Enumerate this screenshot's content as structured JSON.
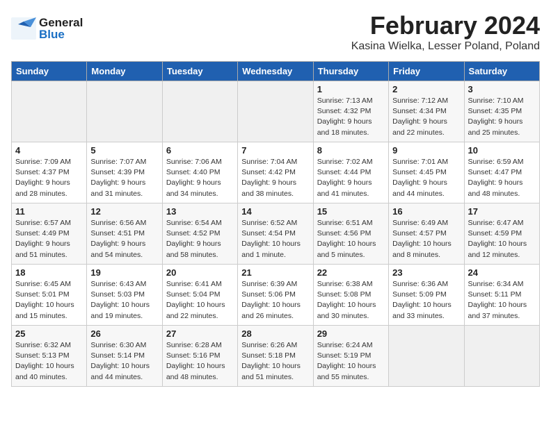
{
  "header": {
    "logo_general": "General",
    "logo_blue": "Blue",
    "month_year": "February 2024",
    "location": "Kasina Wielka, Lesser Poland, Poland"
  },
  "weekdays": [
    "Sunday",
    "Monday",
    "Tuesday",
    "Wednesday",
    "Thursday",
    "Friday",
    "Saturday"
  ],
  "weeks": [
    [
      {
        "day": "",
        "info": ""
      },
      {
        "day": "",
        "info": ""
      },
      {
        "day": "",
        "info": ""
      },
      {
        "day": "",
        "info": ""
      },
      {
        "day": "1",
        "info": "Sunrise: 7:13 AM\nSunset: 4:32 PM\nDaylight: 9 hours\nand 18 minutes."
      },
      {
        "day": "2",
        "info": "Sunrise: 7:12 AM\nSunset: 4:34 PM\nDaylight: 9 hours\nand 22 minutes."
      },
      {
        "day": "3",
        "info": "Sunrise: 7:10 AM\nSunset: 4:35 PM\nDaylight: 9 hours\nand 25 minutes."
      }
    ],
    [
      {
        "day": "4",
        "info": "Sunrise: 7:09 AM\nSunset: 4:37 PM\nDaylight: 9 hours\nand 28 minutes."
      },
      {
        "day": "5",
        "info": "Sunrise: 7:07 AM\nSunset: 4:39 PM\nDaylight: 9 hours\nand 31 minutes."
      },
      {
        "day": "6",
        "info": "Sunrise: 7:06 AM\nSunset: 4:40 PM\nDaylight: 9 hours\nand 34 minutes."
      },
      {
        "day": "7",
        "info": "Sunrise: 7:04 AM\nSunset: 4:42 PM\nDaylight: 9 hours\nand 38 minutes."
      },
      {
        "day": "8",
        "info": "Sunrise: 7:02 AM\nSunset: 4:44 PM\nDaylight: 9 hours\nand 41 minutes."
      },
      {
        "day": "9",
        "info": "Sunrise: 7:01 AM\nSunset: 4:45 PM\nDaylight: 9 hours\nand 44 minutes."
      },
      {
        "day": "10",
        "info": "Sunrise: 6:59 AM\nSunset: 4:47 PM\nDaylight: 9 hours\nand 48 minutes."
      }
    ],
    [
      {
        "day": "11",
        "info": "Sunrise: 6:57 AM\nSunset: 4:49 PM\nDaylight: 9 hours\nand 51 minutes."
      },
      {
        "day": "12",
        "info": "Sunrise: 6:56 AM\nSunset: 4:51 PM\nDaylight: 9 hours\nand 54 minutes."
      },
      {
        "day": "13",
        "info": "Sunrise: 6:54 AM\nSunset: 4:52 PM\nDaylight: 9 hours\nand 58 minutes."
      },
      {
        "day": "14",
        "info": "Sunrise: 6:52 AM\nSunset: 4:54 PM\nDaylight: 10 hours\nand 1 minute."
      },
      {
        "day": "15",
        "info": "Sunrise: 6:51 AM\nSunset: 4:56 PM\nDaylight: 10 hours\nand 5 minutes."
      },
      {
        "day": "16",
        "info": "Sunrise: 6:49 AM\nSunset: 4:57 PM\nDaylight: 10 hours\nand 8 minutes."
      },
      {
        "day": "17",
        "info": "Sunrise: 6:47 AM\nSunset: 4:59 PM\nDaylight: 10 hours\nand 12 minutes."
      }
    ],
    [
      {
        "day": "18",
        "info": "Sunrise: 6:45 AM\nSunset: 5:01 PM\nDaylight: 10 hours\nand 15 minutes."
      },
      {
        "day": "19",
        "info": "Sunrise: 6:43 AM\nSunset: 5:03 PM\nDaylight: 10 hours\nand 19 minutes."
      },
      {
        "day": "20",
        "info": "Sunrise: 6:41 AM\nSunset: 5:04 PM\nDaylight: 10 hours\nand 22 minutes."
      },
      {
        "day": "21",
        "info": "Sunrise: 6:39 AM\nSunset: 5:06 PM\nDaylight: 10 hours\nand 26 minutes."
      },
      {
        "day": "22",
        "info": "Sunrise: 6:38 AM\nSunset: 5:08 PM\nDaylight: 10 hours\nand 30 minutes."
      },
      {
        "day": "23",
        "info": "Sunrise: 6:36 AM\nSunset: 5:09 PM\nDaylight: 10 hours\nand 33 minutes."
      },
      {
        "day": "24",
        "info": "Sunrise: 6:34 AM\nSunset: 5:11 PM\nDaylight: 10 hours\nand 37 minutes."
      }
    ],
    [
      {
        "day": "25",
        "info": "Sunrise: 6:32 AM\nSunset: 5:13 PM\nDaylight: 10 hours\nand 40 minutes."
      },
      {
        "day": "26",
        "info": "Sunrise: 6:30 AM\nSunset: 5:14 PM\nDaylight: 10 hours\nand 44 minutes."
      },
      {
        "day": "27",
        "info": "Sunrise: 6:28 AM\nSunset: 5:16 PM\nDaylight: 10 hours\nand 48 minutes."
      },
      {
        "day": "28",
        "info": "Sunrise: 6:26 AM\nSunset: 5:18 PM\nDaylight: 10 hours\nand 51 minutes."
      },
      {
        "day": "29",
        "info": "Sunrise: 6:24 AM\nSunset: 5:19 PM\nDaylight: 10 hours\nand 55 minutes."
      },
      {
        "day": "",
        "info": ""
      },
      {
        "day": "",
        "info": ""
      }
    ]
  ]
}
